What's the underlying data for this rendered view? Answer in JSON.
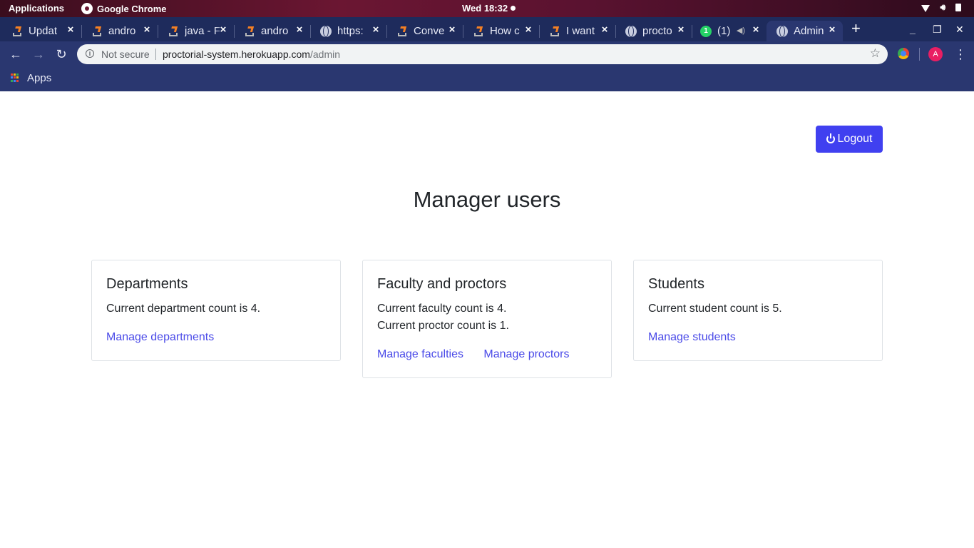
{
  "os_bar": {
    "applications": "Applications",
    "app_name": "Google Chrome",
    "clock": "Wed 18:32"
  },
  "tabs": [
    {
      "title": "Updat",
      "icon": "stackoverflow-icon"
    },
    {
      "title": "andro",
      "icon": "stackoverflow-icon"
    },
    {
      "title": "java - F",
      "icon": "stackoverflow-icon"
    },
    {
      "title": "andro",
      "icon": "stackoverflow-icon"
    },
    {
      "title": "https:",
      "icon": "globe-icon"
    },
    {
      "title": "Conve",
      "icon": "stackoverflow-icon"
    },
    {
      "title": "How c",
      "icon": "stackoverflow-icon"
    },
    {
      "title": "I want",
      "icon": "stackoverflow-icon"
    },
    {
      "title": "procto",
      "icon": "globe-icon"
    },
    {
      "title": "(1)",
      "icon": "whatsapp-icon"
    },
    {
      "title": "Admin",
      "icon": "globe-icon",
      "active": true
    }
  ],
  "address_bar": {
    "security": "Not secure",
    "domain": "proctorial-system.herokuapp.com",
    "path": "/admin"
  },
  "profile_initial": "A",
  "bookmarks": {
    "apps_label": "Apps"
  },
  "page": {
    "logout_label": "Logout",
    "title": "Manager users",
    "cards": [
      {
        "title": "Departments",
        "lines": [
          "Current department count is 4."
        ],
        "links": [
          "Manage departments"
        ]
      },
      {
        "title": "Faculty and proctors",
        "lines": [
          "Current faculty count is 4.",
          "Current proctor count is 1."
        ],
        "links": [
          "Manage faculties",
          "Manage proctors"
        ]
      },
      {
        "title": "Students",
        "lines": [
          "Current student count is 5."
        ],
        "links": [
          "Manage students"
        ]
      }
    ]
  },
  "colors": {
    "primary": "#4040f0",
    "link": "#4a4ae8",
    "browser_frame": "#2a3770"
  }
}
